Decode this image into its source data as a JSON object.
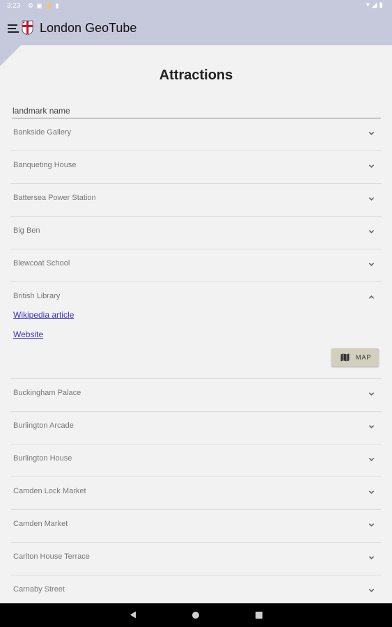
{
  "status_bar": {
    "time": "3:23",
    "left_icons": [
      "settings-icon",
      "notification-icon",
      "cast-icon",
      "sd-card-icon"
    ],
    "right_icons": [
      "wifi-icon",
      "signal-icon",
      "battery-icon"
    ]
  },
  "app_bar": {
    "title": "London GeoTube",
    "menu_icon": "menu-icon",
    "logo_icon": "st-george-flag-icon"
  },
  "page": {
    "title": "Attractions",
    "search_placeholder": "landmark name"
  },
  "items": [
    {
      "label": "Bankside Gallery",
      "expanded": false
    },
    {
      "label": "Banqueting House",
      "expanded": false
    },
    {
      "label": "Battersea Power Station",
      "expanded": false
    },
    {
      "label": "Big Ben",
      "expanded": false
    },
    {
      "label": "Blewcoat School",
      "expanded": false
    },
    {
      "label": "British Library",
      "expanded": true
    },
    {
      "label": "Buckingham Palace",
      "expanded": false
    },
    {
      "label": "Burlington Arcade",
      "expanded": false
    },
    {
      "label": "Burlington House",
      "expanded": false
    },
    {
      "label": "Camden Lock Market",
      "expanded": false
    },
    {
      "label": "Camden Market",
      "expanded": false
    },
    {
      "label": "Carlton House Terrace",
      "expanded": false
    },
    {
      "label": "Carnaby Street",
      "expanded": false
    }
  ],
  "expanded_detail": {
    "wikipedia_link": "Wikipedia article",
    "website_link": "Website",
    "map_button": "MAP",
    "map_icon": "map-icon"
  },
  "nav_bar": {
    "icons": [
      "back-icon",
      "home-icon",
      "recents-icon"
    ]
  },
  "colors": {
    "app_bar": "#c6c9dc",
    "background": "#f2f2f2",
    "link": "#3a2fd6",
    "map_button": "#d3cfbe"
  }
}
